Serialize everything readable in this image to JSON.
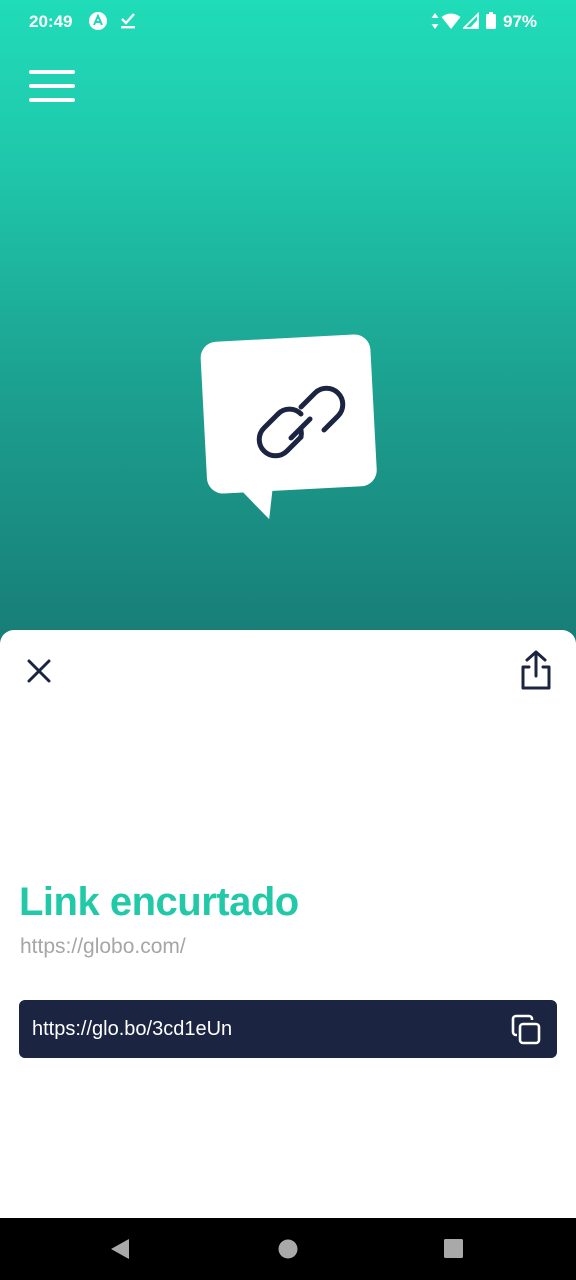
{
  "status_bar": {
    "time": "20:49",
    "battery": "97%",
    "icons": [
      "app-notification-icon",
      "download-done-icon",
      "data-arrows-icon",
      "wifi-icon",
      "cell-signal-icon",
      "battery-icon"
    ]
  },
  "header": {
    "menu_icon": "hamburger-menu-icon",
    "logo_icon": "chat-bubble-link-icon"
  },
  "sheet": {
    "close_icon": "close-icon",
    "share_icon": "share-icon",
    "title": "Link encurtado",
    "original_url": "https://globo.com/",
    "short_url": "https://glo.bo/3cd1eUn",
    "copy_icon": "copy-icon"
  },
  "nav_bar": {
    "buttons": [
      "back-icon",
      "home-icon",
      "recents-icon"
    ]
  },
  "colors": {
    "accent": "#22c9a8",
    "hero_top": "#20dcb8",
    "hero_bottom": "#177b74",
    "dark": "#1b2541",
    "muted_text": "#a6a6a6"
  }
}
